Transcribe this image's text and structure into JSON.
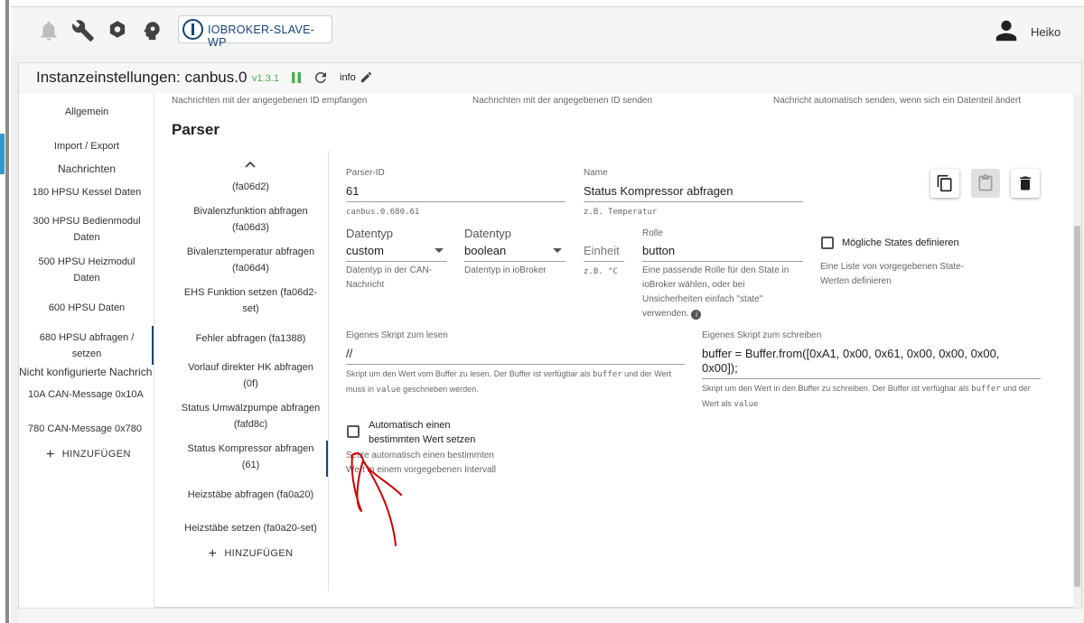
{
  "topbar": {
    "instance_button": "IOBROKER-SLAVE-WP",
    "user_name": "Heiko",
    "icons": [
      "bell-icon",
      "wrench-icon",
      "settings-icon",
      "head-icon",
      "user-icon"
    ]
  },
  "header": {
    "title": "Instanzeinstellungen: canbus.0",
    "version": "v1.3.1",
    "info_label": "info"
  },
  "colors": {
    "accent": "#164477",
    "status_green": "#4caf50",
    "annotation_red": "#cc0000"
  },
  "sidebar": {
    "items": [
      {
        "label": "Allgemein"
      },
      {
        "label": "Import / Export"
      },
      {
        "label": "Nachrichten"
      },
      {
        "label": "180 HPSU Kessel Daten"
      },
      {
        "label": "300 HPSU Bedienmodul Daten"
      },
      {
        "label": "500 HPSU Heizmodul Daten"
      },
      {
        "label": "600 HPSU Daten"
      },
      {
        "label": "680 HPSU abfragen / setzen"
      },
      {
        "label": "Nicht konfigurierte Nachrich"
      },
      {
        "label": "10A CAN-Message 0x10A"
      },
      {
        "label": "780 CAN-Message 0x780"
      }
    ],
    "add_label": "HINZUFÜGEN"
  },
  "section": {
    "header_receive": "Nachrichten mit der angegebenen ID empfangen",
    "header_send": "Nachrichten mit der angegebenen ID senden",
    "header_auto": "Nachricht automatisch senden, wenn sich ein Datenteil ändert",
    "parser_title": "Parser"
  },
  "parser_list": {
    "items": [
      {
        "label": "(fa06d2)"
      },
      {
        "label": "Bivalenzfunktion abfragen (fa06d3)"
      },
      {
        "label": "Bivalenztemperatur abfragen (fa06d4)"
      },
      {
        "label": "EHS Funktion setzen (fa06d2-set)"
      },
      {
        "label": "Fehler abfragen (fa1388)"
      },
      {
        "label": "Vorlauf direkter HK abfragen (0f)"
      },
      {
        "label": "Status Umwälzpumpe abfragen (fafd8c)"
      },
      {
        "label": "Status Kompressor abfragen (61)"
      },
      {
        "label": "Heizstäbe abfragen (fa0a20)"
      },
      {
        "label": "Heizstäbe setzen (fa0a20-set)"
      }
    ],
    "add_label": "HINZUFÜGEN"
  },
  "form": {
    "parser_id_label": "Parser-ID",
    "parser_id_value": "61",
    "parser_id_helper": "canbus.0.680.61",
    "name_label": "Name",
    "name_value": "Status Kompressor abfragen",
    "name_helper": "z.B. Temperatur",
    "datatype_can_label": "Datentyp",
    "datatype_can_value": "custom",
    "datatype_can_helper": "Datentyp in der CAN-Nachricht",
    "datatype_io_label": "Datentyp",
    "datatype_io_value": "boolean",
    "datatype_io_helper": "Datentyp in ioBroker",
    "unit_label": "Einheit",
    "unit_helper": "z.B. °C",
    "role_label": "Rolle",
    "role_value": "button",
    "role_helper": "Eine passende Rolle für den State in ioBroker wählen, oder bei Unsicherheiten einfach \"state\" verwenden.",
    "states_label": "Mögliche States definieren",
    "states_helper": "Eine Liste von vorgegebenen State-Werten definieren",
    "read_script_label": "Eigenes Skript zum lesen",
    "read_script_value": "//",
    "read_script_helper_1": "Skript um den Wert vom Buffer zu lesen. Der Buffer ist verfügbar als",
    "read_script_helper_buffer": "buffer",
    "read_script_helper_2": "und der Wert muss in",
    "read_script_helper_value": "value",
    "read_script_helper_3": "geschrieben werden.",
    "write_script_label": "Eigenes Skript zum schreiben",
    "write_script_value": "buffer = Buffer.from([0xA1, 0x00, 0x61, 0x00, 0x00, 0x00, 0x00]);",
    "write_script_helper_1": "Skript um den Wert in den Buffer zu schreiben. Der Buffer ist verfügbar als",
    "write_script_helper_buffer": "buffer",
    "write_script_helper_2": "und der Wert als",
    "write_script_helper_value": "value",
    "auto_set_label": "Automatisch einen bestimmten Wert setzen",
    "auto_set_helper": "Setze automatisch einen bestimmten Wert in einem vorgegebenen Intervall"
  }
}
